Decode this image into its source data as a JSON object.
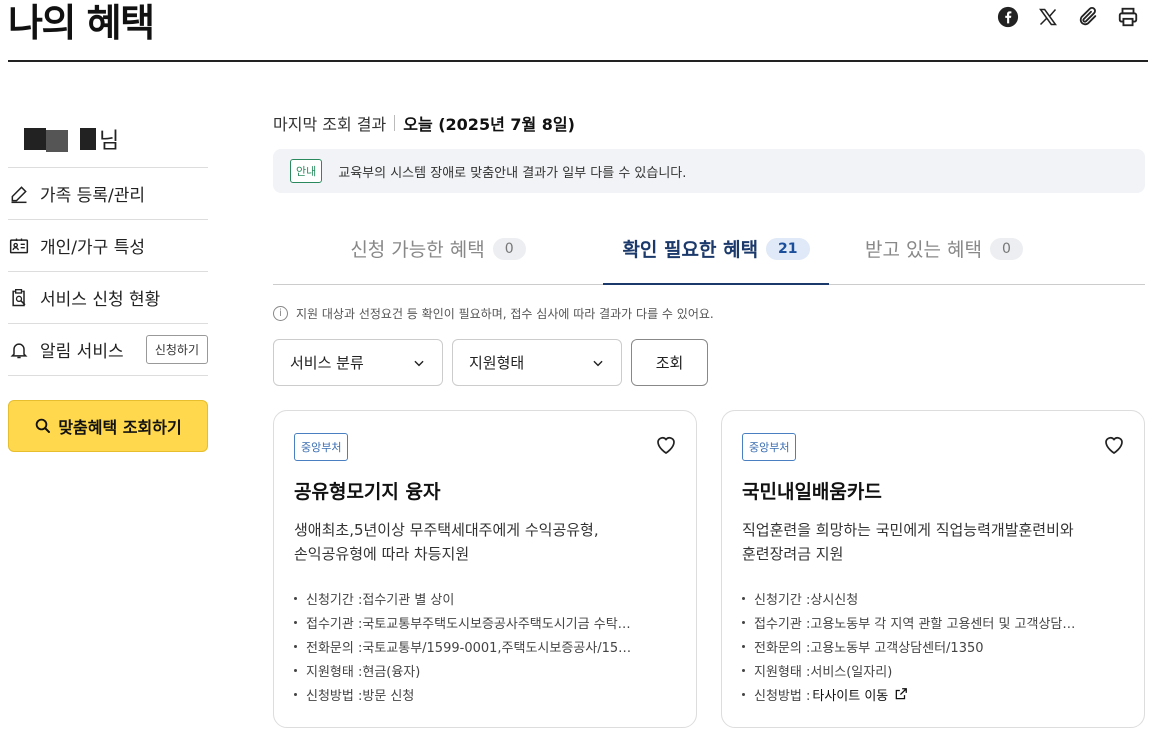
{
  "header": {
    "title": "나의 혜택",
    "icons": [
      "facebook-icon",
      "x-icon",
      "link-icon",
      "print-icon"
    ]
  },
  "sidebar": {
    "user_suffix": "님",
    "items": [
      {
        "label": "가족 등록/관리",
        "icon": "pencil-icon"
      },
      {
        "label": "개인/가구 특성",
        "icon": "id-card-icon"
      },
      {
        "label": "서비스 신청 현황",
        "icon": "clipboard-search-icon"
      },
      {
        "label": "알림 서비스",
        "icon": "bell-icon",
        "button": "신청하기"
      }
    ],
    "cta": "맞춤혜택 조회하기"
  },
  "main": {
    "last_query_label": "마지막 조회 결과",
    "last_query_value": "오늘 (2025년 7월 8일)",
    "notice_badge": "안내",
    "notice_text": "교육부의 시스템 장애로 맞춤안내 결과가 일부 다를 수 있습니다.",
    "tabs": [
      {
        "label": "신청 가능한 혜택",
        "count": "0",
        "active": false
      },
      {
        "label": "확인 필요한 혜택",
        "count": "21",
        "active": true
      },
      {
        "label": "받고 있는 혜택",
        "count": "0",
        "active": false
      }
    ],
    "info_text": "지원 대상과 선정요건 등 확인이 필요하며, 접수 심사에 따라 결과가 다를 수 있어요.",
    "filters": {
      "service_category": "서비스 분류",
      "support_type": "지원형태",
      "query_button": "조회"
    },
    "cards": [
      {
        "tag": "중앙부처",
        "title": "공유형모기지 융자",
        "desc_line1": "생애최초,5년이상 무주택세대주에게 수익공유형,",
        "desc_line2": "손익공유형에 따라 차등지원",
        "details": [
          {
            "label": "신청기간 : ",
            "value": "접수기관 별 상이"
          },
          {
            "label": "접수기관 : ",
            "value": "국토교통부주택도시보증공사주택도시기금 수탁…"
          },
          {
            "label": "전화문의 : ",
            "value": "국토교통부/1599-0001,주택도시보증공사/15…"
          },
          {
            "label": "지원형태 : ",
            "value": "현금(융자)"
          },
          {
            "label": "신청방법 : ",
            "value": "방문 신청"
          }
        ]
      },
      {
        "tag": "중앙부처",
        "title": "국민내일배움카드",
        "desc_line1": "직업훈련을 희망하는 국민에게 직업능력개발훈련비와",
        "desc_line2": "훈련장려금 지원",
        "details": [
          {
            "label": "신청기간 : ",
            "value": "상시신청"
          },
          {
            "label": "접수기관 : ",
            "value": "고용노동부 각 지역 관할 고용센터 및 고객상담…"
          },
          {
            "label": "전화문의 : ",
            "value": "고용노동부 고객상담센터/1350"
          },
          {
            "label": "지원형태 : ",
            "value": "서비스(일자리)"
          },
          {
            "label": "신청방법 : ",
            "value": "타사이트 이동"
          }
        ]
      }
    ]
  },
  "colors": {
    "accent_navy": "#1b3a6b",
    "cta_yellow": "#ffd84d",
    "badge_green": "#2a8a5e",
    "tag_blue": "#3a6db3"
  }
}
